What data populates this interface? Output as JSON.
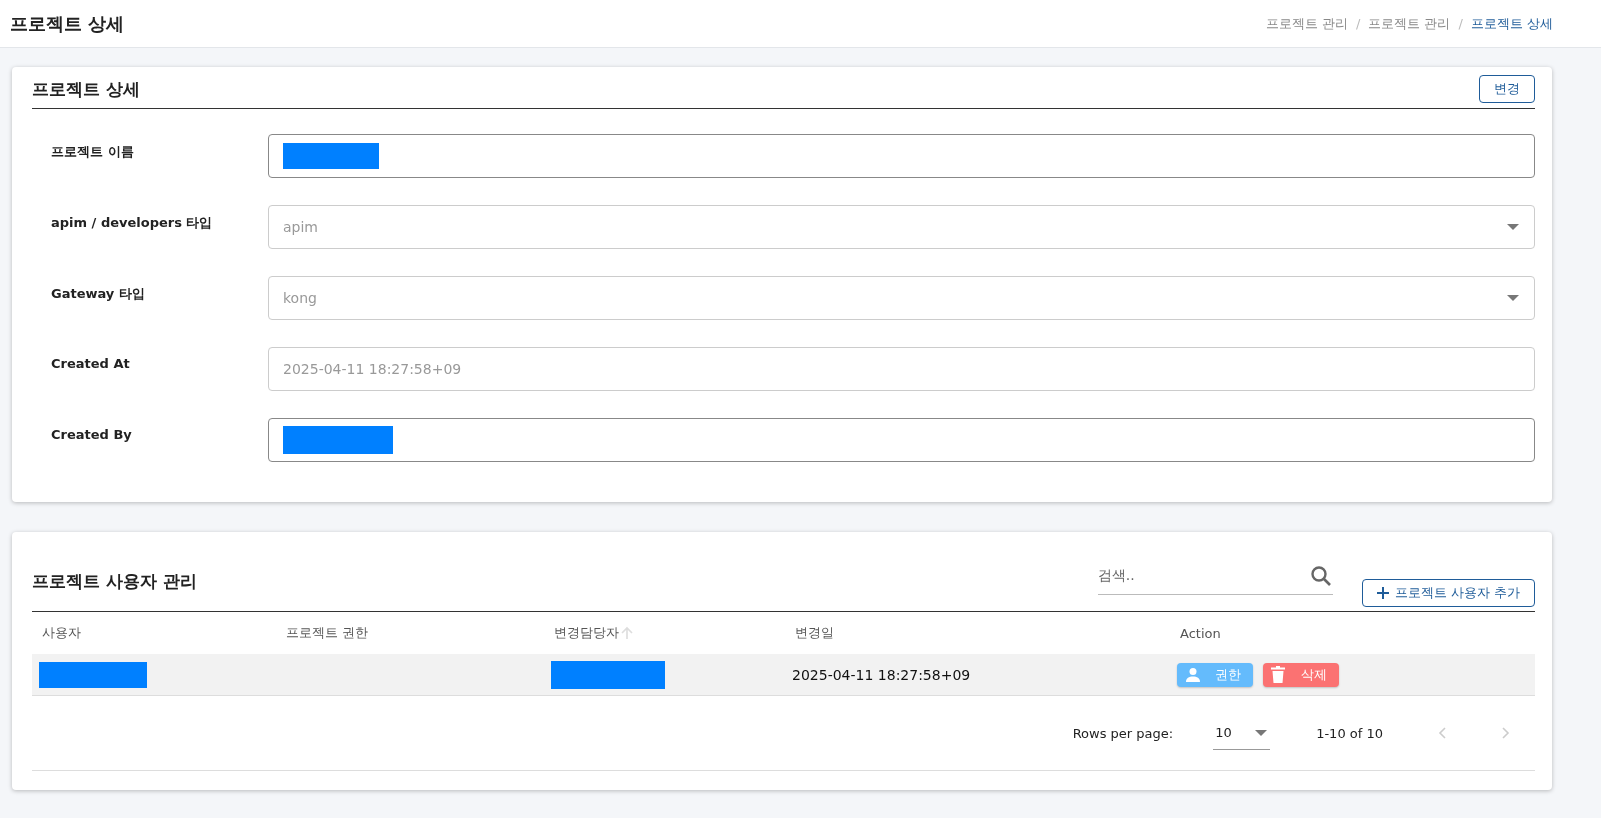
{
  "header": {
    "title": "프로젝트 상세",
    "breadcrumb_separator": "/",
    "breadcrumb": [
      {
        "label": "프로젝트 관리",
        "selected": false
      },
      {
        "label": "프로젝트 관리",
        "selected": false
      },
      {
        "label": "프로젝트 상세",
        "selected": true
      }
    ]
  },
  "detail": {
    "title": "프로젝트 상세",
    "edit_button": "변경",
    "fields": [
      {
        "label": "프로젝트 이름",
        "kind": "redacted",
        "disabled": false
      },
      {
        "label": "apim / developers 타입",
        "kind": "select",
        "value": "apim",
        "disabled": true
      },
      {
        "label": "Gateway 타입",
        "kind": "select",
        "value": "kong",
        "disabled": true
      },
      {
        "label": "Created At",
        "kind": "text",
        "value": "2025-04-11 18:27:58+09",
        "disabled": true
      },
      {
        "label": "Created By",
        "kind": "redacted",
        "disabled": false
      }
    ]
  },
  "users": {
    "title": "프로젝트 사용자 관리",
    "search": {
      "placeholder": "검색.."
    },
    "add_button": "프로젝트 사용자 추가",
    "table": {
      "columns": [
        {
          "label": "사용자",
          "sortable": false
        },
        {
          "label": "프로젝트 권한",
          "sortable": false
        },
        {
          "label": "변경담당자",
          "sortable": true
        },
        {
          "label": "변경일",
          "sortable": false
        },
        {
          "label": "Action",
          "sortable": false
        }
      ],
      "rows": [
        {
          "cells": [
            {
              "kind": "redacted"
            },
            {
              "kind": "text",
              "text": ""
            },
            {
              "kind": "redacted"
            },
            {
              "kind": "text",
              "text": "2025-04-11 18:27:58+09"
            },
            {
              "kind": "actions",
              "buttons": [
                {
                  "kind": "permission",
                  "label": "권한"
                },
                {
                  "kind": "delete",
                  "label": "삭제"
                }
              ]
            }
          ]
        }
      ]
    },
    "pagination": {
      "rows_per_page_label": "Rows per page:",
      "rows_per_page": "10",
      "range": "1-10 of 10",
      "prev_disabled": true,
      "next_disabled": true
    }
  }
}
